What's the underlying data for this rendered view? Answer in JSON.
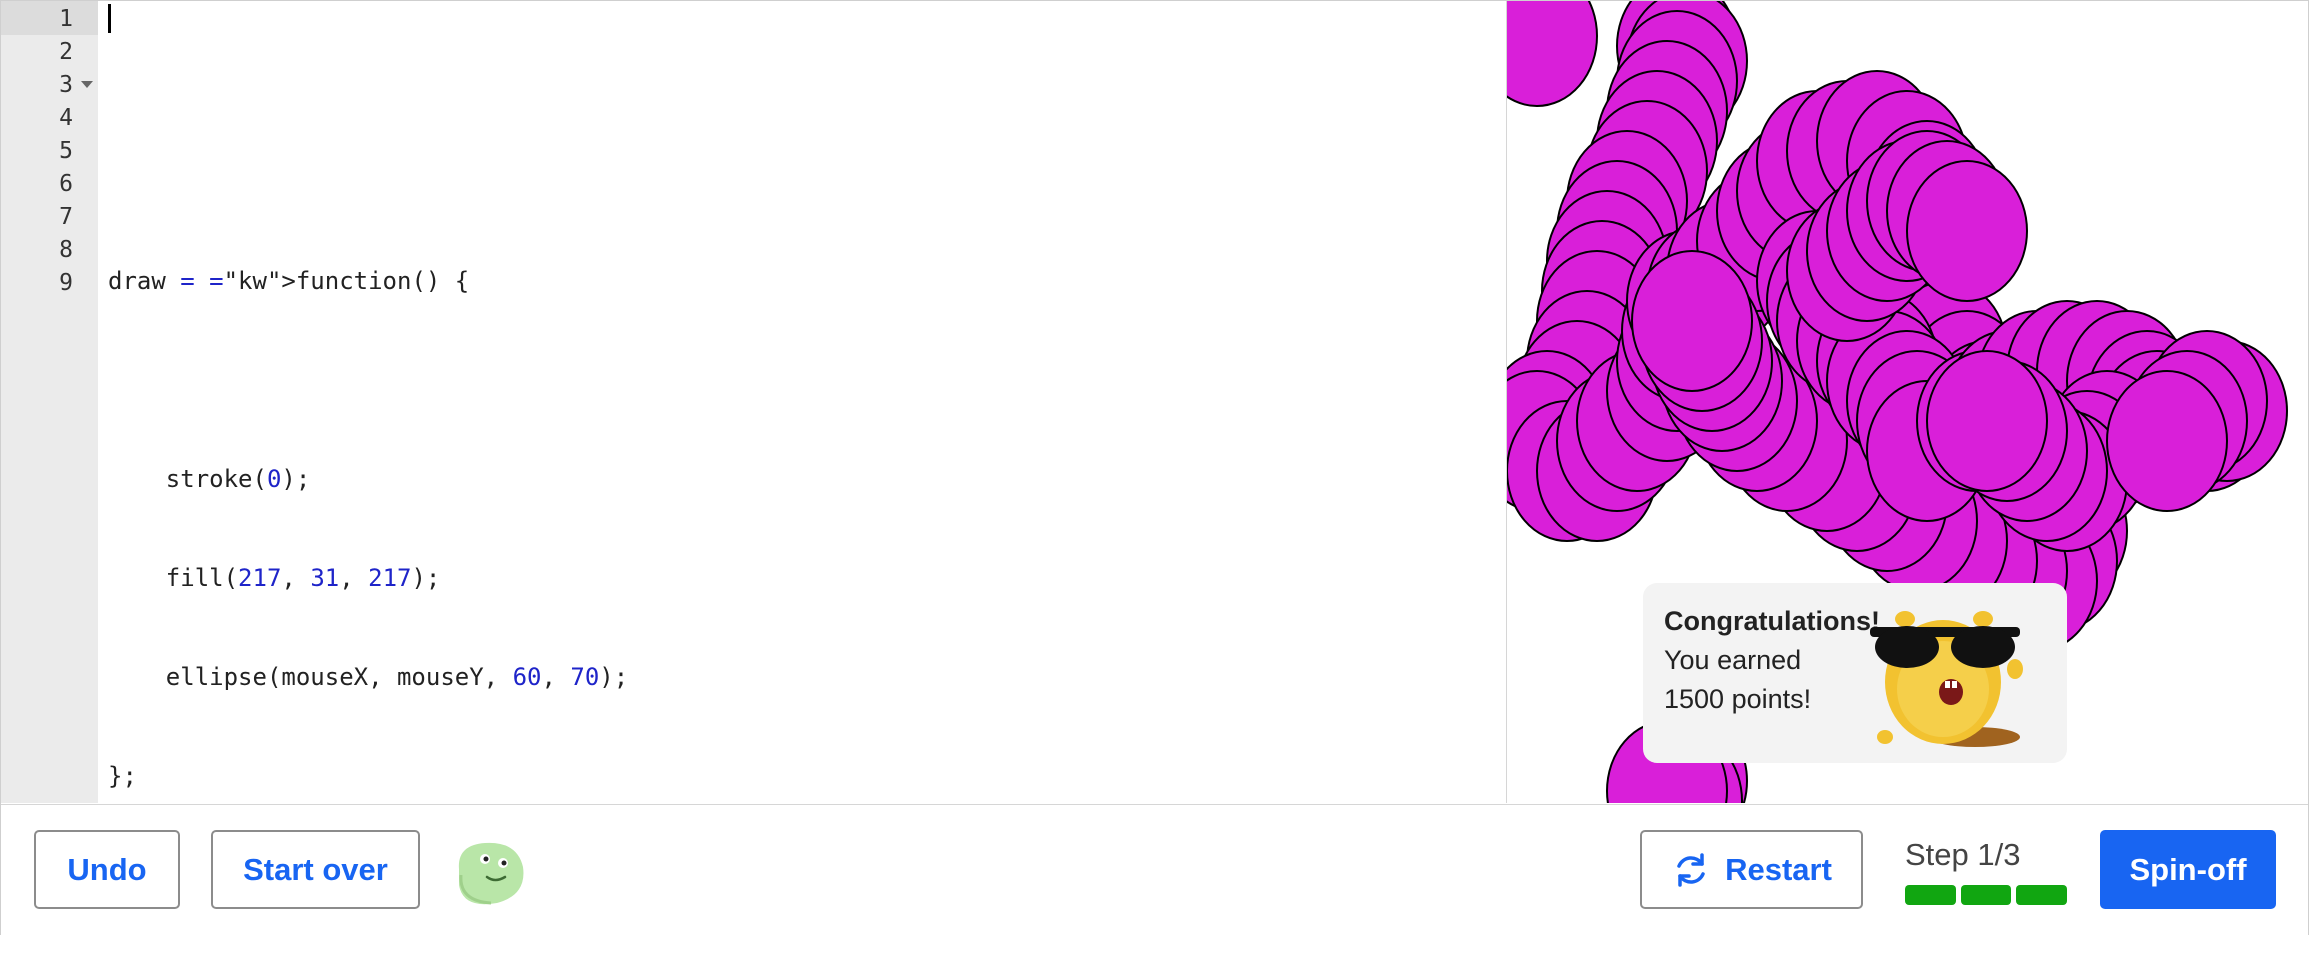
{
  "editor": {
    "line_numbers": [
      "1",
      "2",
      "3",
      "4",
      "5",
      "6",
      "7",
      "8",
      "9"
    ],
    "lines": [
      "",
      "",
      "draw = function() {",
      "",
      "    stroke(0);",
      "    fill(217, 31, 217);",
      "    ellipse(mouseX, mouseY, 60, 70);",
      "};",
      ""
    ]
  },
  "canvas": {
    "fill_color": "#d91fd9",
    "stroke_color": "#000000"
  },
  "toast": {
    "title": "Congratulations!",
    "line1": "You earned",
    "line2": "1500 points!"
  },
  "toolbar": {
    "undo_label": "Undo",
    "start_over_label": "Start over",
    "restart_label": "Restart",
    "step_label": "Step 1/3",
    "progress_filled": 3,
    "progress_total": 3,
    "spinoff_label": "Spin-off",
    "accent_color": "#1865f2",
    "progress_color": "#11a611"
  }
}
